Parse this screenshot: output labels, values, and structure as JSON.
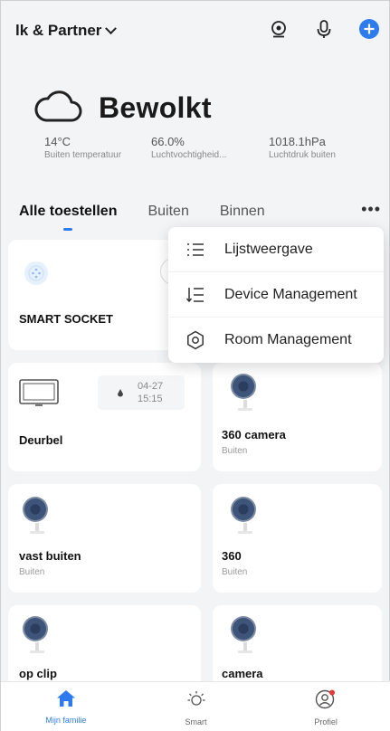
{
  "header": {
    "home_name": "lk & Partner",
    "icons": [
      "camera-icon",
      "microphone-icon",
      "add-icon"
    ],
    "accent_color": "#2e7bf0"
  },
  "weather": {
    "condition": "Bewolkt",
    "stats": [
      {
        "value": "14°C",
        "label": "Buiten temperatuur"
      },
      {
        "value": "66.0%",
        "label": "Luchtvochtigheid..."
      },
      {
        "value": "1018.1hPa",
        "label": "Luchtdruk buiten"
      }
    ]
  },
  "tabs": [
    {
      "label": "Alle toestellen",
      "active": true
    },
    {
      "label": "Buiten",
      "active": false
    },
    {
      "label": "Binnen",
      "active": false
    }
  ],
  "more_label": "•••",
  "menu": {
    "items": [
      {
        "label": "Lijstweergave",
        "icon": "list-icon"
      },
      {
        "label": "Device Management",
        "icon": "sort-list-icon"
      },
      {
        "label": "Room Management",
        "icon": "gear-icon"
      }
    ]
  },
  "devices": [
    {
      "name": "SMART SOCKET",
      "room": ""
    },
    {
      "name": "Deurbel",
      "room": "",
      "badge_date": "04-27",
      "badge_time": "15:15"
    },
    {
      "name": "360 camera",
      "room": "Buiten"
    },
    {
      "name": "vast buiten",
      "room": "Buiten"
    },
    {
      "name": "360",
      "room": "Buiten"
    },
    {
      "name": "op clip",
      "room": ""
    },
    {
      "name": "camera",
      "room": ""
    }
  ],
  "bottom_nav": [
    {
      "label": "Mijn familie",
      "icon": "home-icon",
      "active": true
    },
    {
      "label": "Smart",
      "icon": "sun-icon",
      "active": false
    },
    {
      "label": "Profiel",
      "icon": "profile-icon",
      "active": false
    }
  ]
}
